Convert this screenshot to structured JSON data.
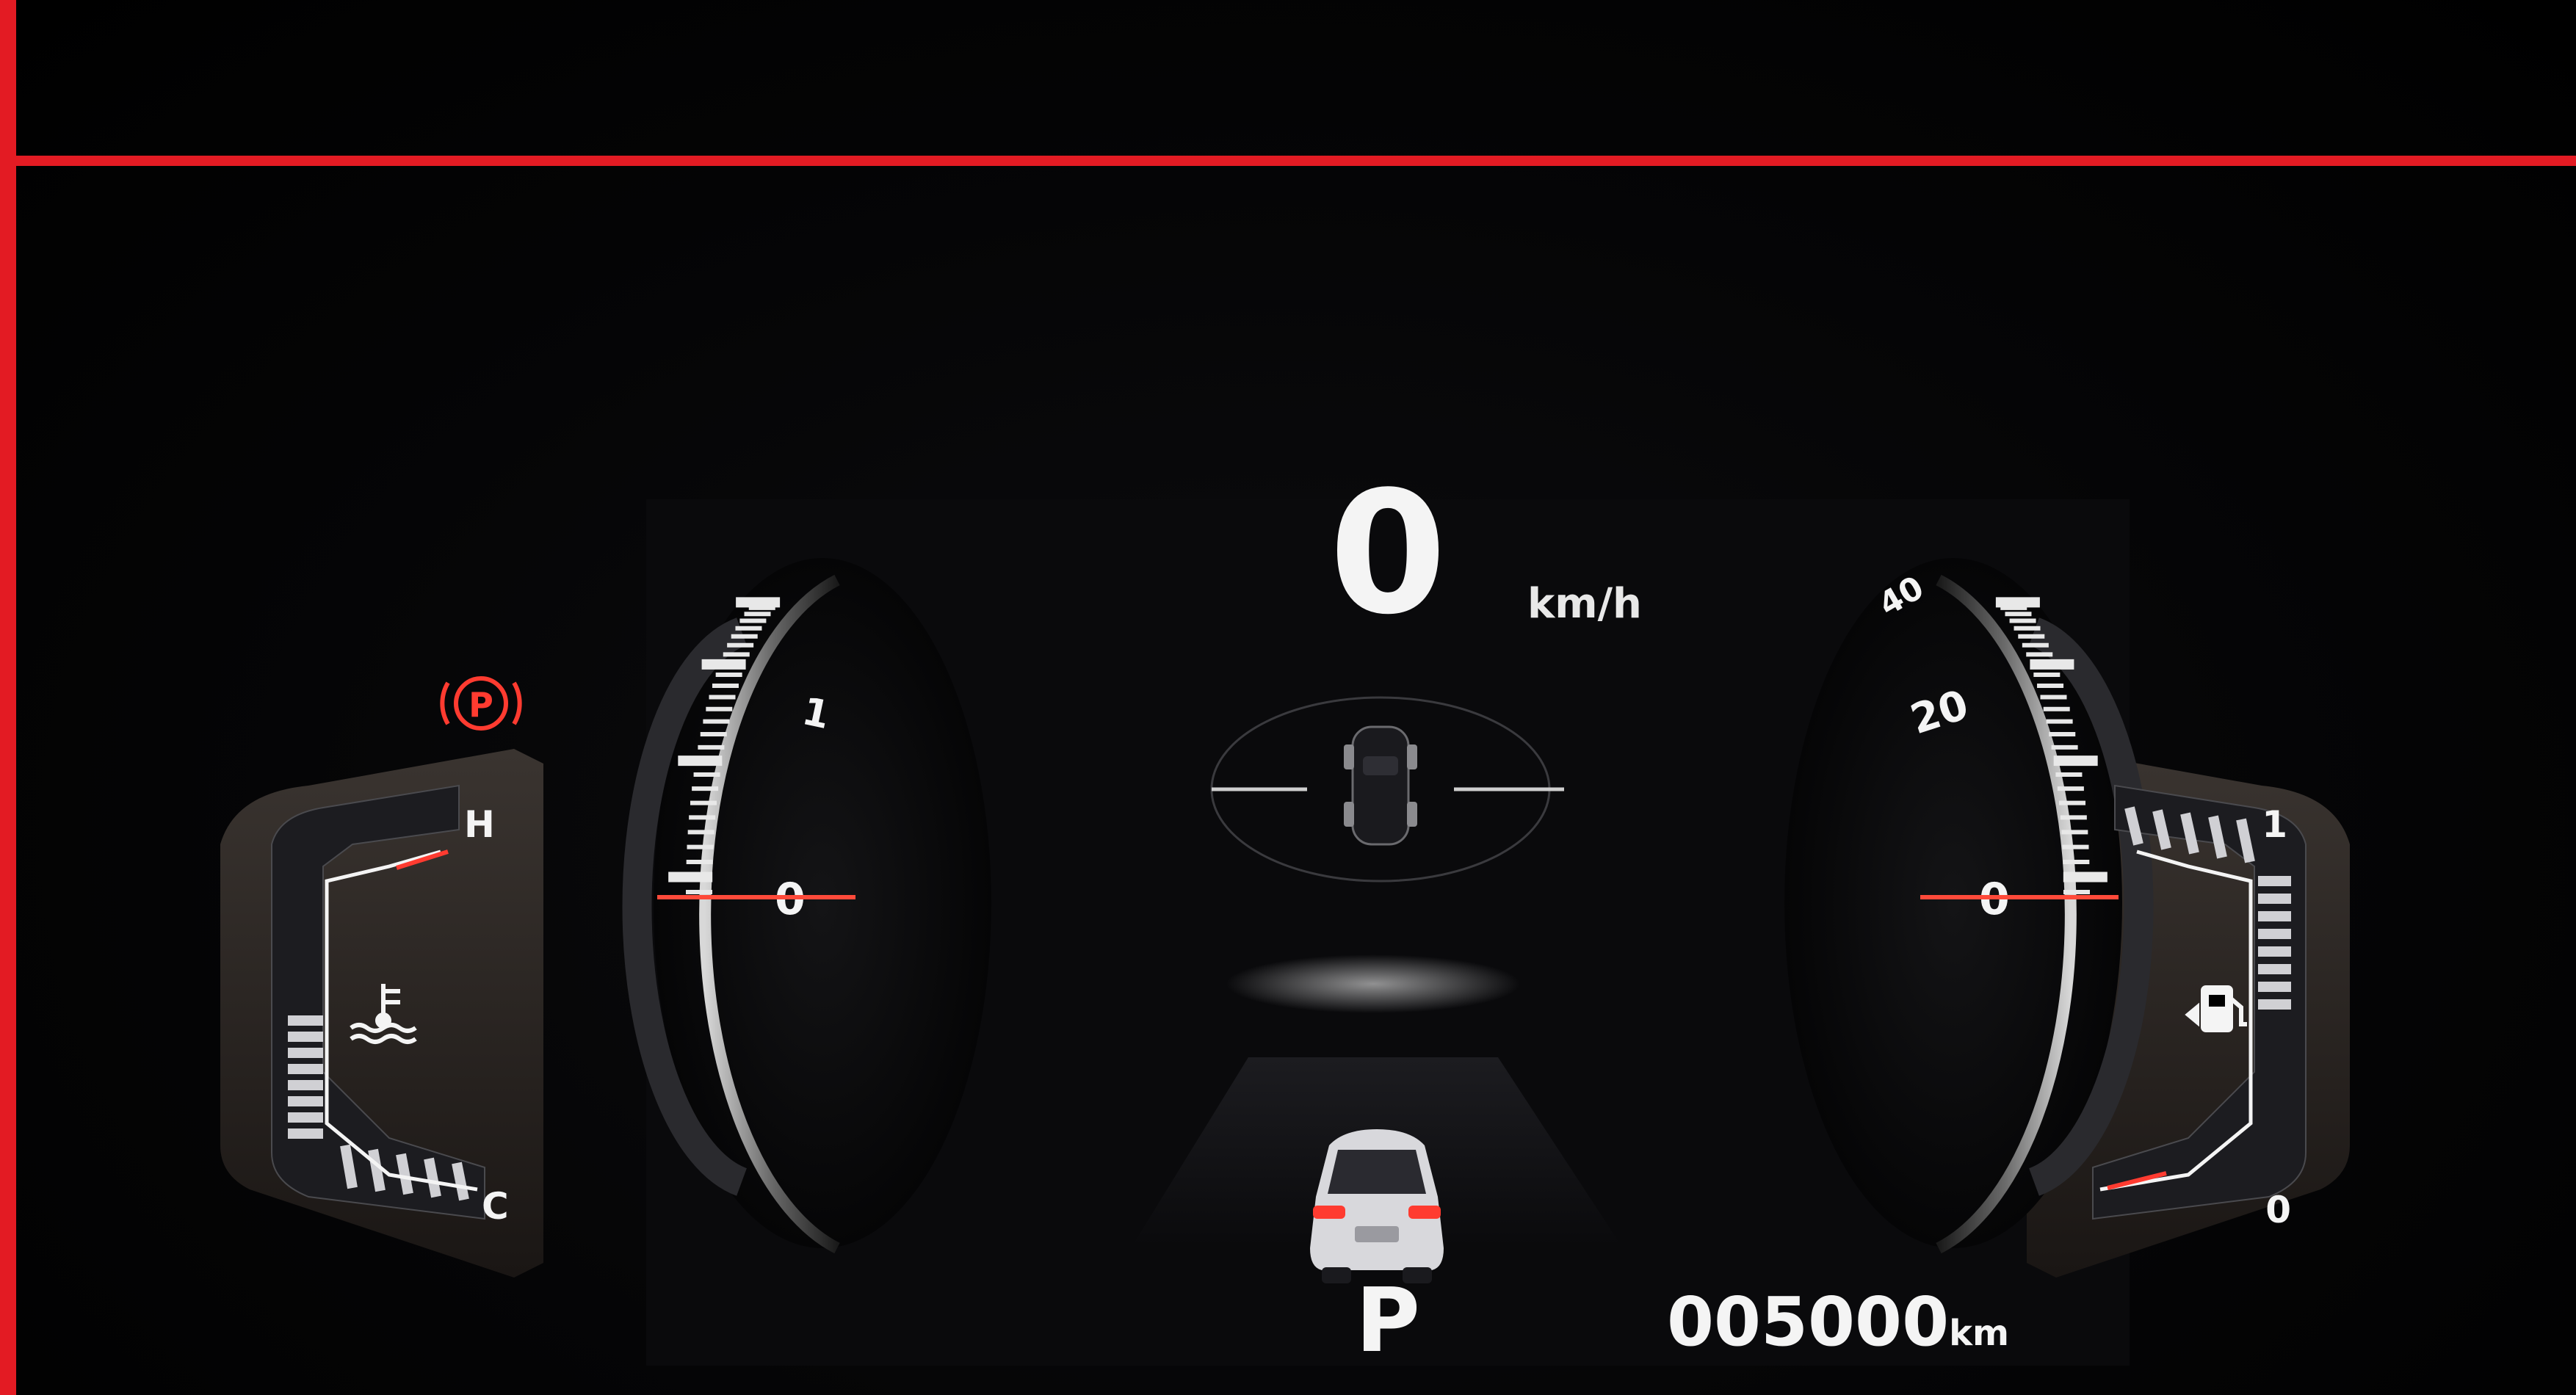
{
  "speedometer": {
    "value": "0",
    "unit": "km/h"
  },
  "left_dial": {
    "tick_labels": [
      "1",
      "0"
    ]
  },
  "right_dial": {
    "tick_labels": [
      "40",
      "20",
      "0"
    ]
  },
  "temperature_gauge": {
    "hot_label": "H",
    "cold_label": "C"
  },
  "fuel_gauge": {
    "full_label": "1",
    "empty_label": "0"
  },
  "transmission": {
    "gear": "P"
  },
  "odometer": {
    "value": "005000",
    "unit": "km"
  },
  "indicators": {
    "parking_brake": "P"
  },
  "colors": {
    "frame_accent": "#e31b23",
    "warning": "#ff3b30",
    "needle": "#ff4a3a",
    "text": "#f4f4f4"
  },
  "icons": [
    "parking-brake-icon",
    "coolant-temperature-icon",
    "fuel-pump-icon",
    "vehicle-rear-icon",
    "vehicle-top-icon"
  ]
}
